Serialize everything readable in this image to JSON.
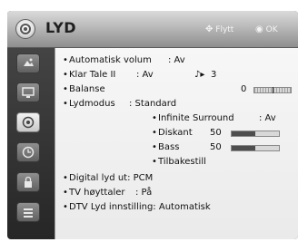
{
  "header": {
    "title": "LYD",
    "move_icon": "move-arrows-icon",
    "move_label": "Flytt",
    "ok_icon": "ok-circle-icon",
    "ok_label": "OK"
  },
  "sidebar": {
    "items": [
      {
        "icon": "picture-icon",
        "active": false
      },
      {
        "icon": "screen-icon",
        "active": false
      },
      {
        "icon": "sound-icon",
        "active": true
      },
      {
        "icon": "clock-icon",
        "active": false
      },
      {
        "icon": "lock-icon",
        "active": false
      },
      {
        "icon": "option-icon",
        "active": false
      }
    ]
  },
  "settings": {
    "auto_volume": {
      "label": "Automatisk volum",
      "value": ": Av"
    },
    "clear_voice": {
      "label": "Klar Tale II",
      "value": ": Av",
      "level": "3"
    },
    "balance": {
      "label": "Balanse",
      "value": "0",
      "level_fraction": 0.5
    },
    "sound_mode": {
      "label": "Lydmodus",
      "value": ": Standard"
    },
    "infinite_surround": {
      "label": "Infinite Surround",
      "value": ": Av"
    },
    "treble": {
      "label": "Diskant",
      "value": "50",
      "level_percent": 50
    },
    "bass": {
      "label": "Bass",
      "value": "50",
      "level_percent": 50
    },
    "reset": {
      "label": "Tilbakestill"
    },
    "digital_out": {
      "label": "Digital lyd ut: PCM"
    },
    "tv_speakers": {
      "label": "TV høyttaler",
      "value": ": På"
    },
    "dtv_audio": {
      "label": "DTV Lyd innstilling: Automatisk"
    }
  },
  "colors": {
    "fill": "#4e4e4e",
    "panel": "#f2f2f2",
    "header": "#b9b9b9"
  }
}
